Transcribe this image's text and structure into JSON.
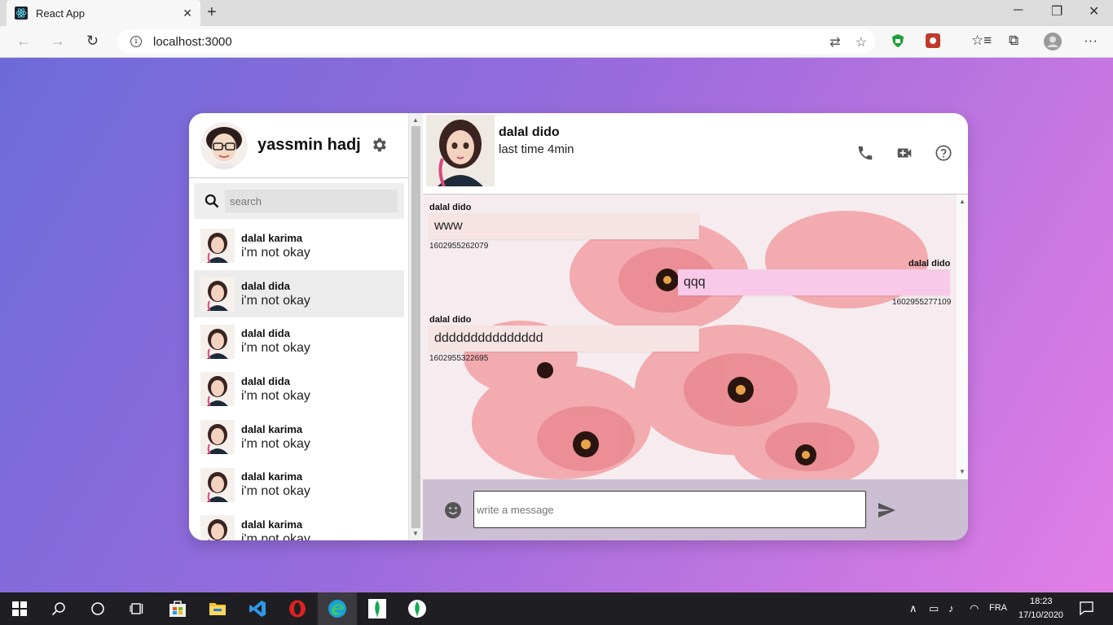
{
  "browser": {
    "tab_title": "React App",
    "tab_close": "✕",
    "new_tab": "+",
    "url": "localhost:3000",
    "window_controls": {
      "minimize": "─",
      "restore": "❐",
      "close": "✕"
    }
  },
  "sidebar": {
    "user_name": "yassmin hadj",
    "search_placeholder": "search",
    "contacts": [
      {
        "name": "dalal karima",
        "message": "i'm not okay"
      },
      {
        "name": "dalal dida",
        "message": "i'm not okay"
      },
      {
        "name": "dalal dida",
        "message": "i'm not okay"
      },
      {
        "name": "dalal dida",
        "message": "i'm not okay"
      },
      {
        "name": "dalal karima",
        "message": "i'm not okay"
      },
      {
        "name": "dalal karima",
        "message": "i'm not okay"
      },
      {
        "name": "dalal karima",
        "message": "i'm not okay"
      }
    ]
  },
  "chat": {
    "contact_name": "dalal dido",
    "status": "last time 4min",
    "messages": [
      {
        "sender": "dalal dido",
        "text": "www",
        "timestamp": "1602955262079",
        "direction": "in"
      },
      {
        "sender": "dalal dido",
        "text": "qqq",
        "timestamp": "1602955277109",
        "direction": "out"
      },
      {
        "sender": "dalal dido",
        "text": "ddddddddddddddd",
        "timestamp": "1602955322695",
        "direction": "in"
      }
    ],
    "input_placeholder": "write a message"
  },
  "taskbar": {
    "language": "FRA",
    "time": "18:23",
    "date": "17/10/2020"
  },
  "colors": {
    "bg_gradient_start": "#6d6bd9",
    "bg_gradient_end": "#e27ee6",
    "bubble_in": "#f6e4e4",
    "bubble_out": "#f8c9e8",
    "composer_bg": "#cdbfd3"
  }
}
